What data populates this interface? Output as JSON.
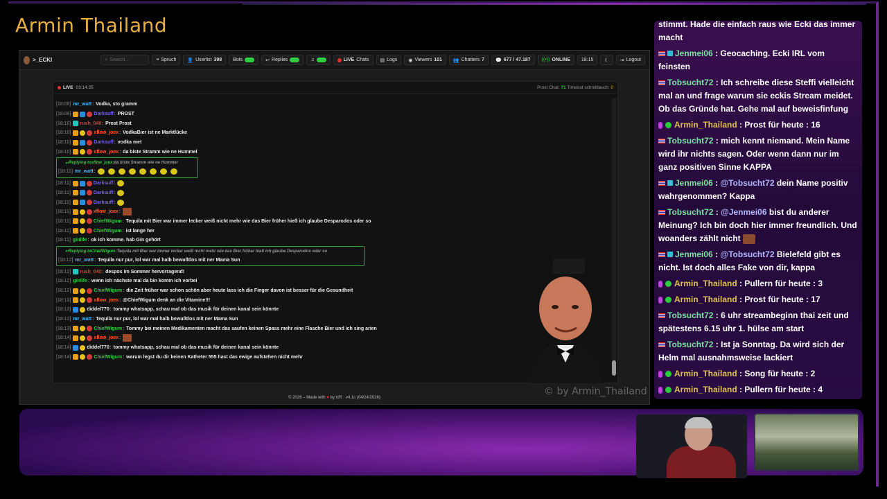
{
  "stream": {
    "title": "Armin Thailand",
    "watermark": "© by Armin_Thailand"
  },
  "navbar": {
    "brand": ">_ECKI",
    "search_placeholder": "Search...",
    "spruch": "Spruch",
    "userlist": "Userlist",
    "userlist_count": "398",
    "bots": "Bots",
    "replies": "Replies",
    "live": "LIVE",
    "chats": "Chats",
    "logs": "Logs",
    "viewers": "Viewers",
    "viewers_count": "101",
    "chatters": "Chatters",
    "chatters_count": "7",
    "messages": "677 / 47.187",
    "online": "ONLINE",
    "clock": "18:15",
    "logout": "Logout"
  },
  "panel": {
    "live_label": "LIVE",
    "uptime": "03:14:35",
    "prost_label": "Prost Chat:",
    "prost_count": "71",
    "timeout_label": "Timeout schnittlauch:",
    "timeout_count": "0"
  },
  "chat": [
    {
      "ts": "[18:09]",
      "user": "mr_watt",
      "color": "#4ab8ff",
      "badges": [],
      "text": "Vodka, sto gramm"
    },
    {
      "ts": "[18:09]",
      "user": "Darksuff",
      "color": "#7a5aff",
      "badges": [
        "crown",
        "sub",
        "mod"
      ],
      "text": "PROST"
    },
    {
      "ts": "[18:10]",
      "user": "rush_040",
      "color": "#e03a3a",
      "badges": [
        "gift"
      ],
      "text": "Prost Prost"
    },
    {
      "ts": "[18:10]",
      "user": "xflow_joex",
      "color": "#ff5a2a",
      "badges": [
        "crown",
        "coin",
        "mod"
      ],
      "text": "VodkaBier ist ne Marktlücke"
    },
    {
      "ts": "[18:10]",
      "user": "Darksuff",
      "color": "#7a5aff",
      "badges": [
        "crown",
        "sub",
        "mod"
      ],
      "text": "vodka met"
    },
    {
      "ts": "[18:10]",
      "user": "xflow_joex",
      "color": "#ff5a2a",
      "badges": [
        "crown",
        "coin",
        "mod"
      ],
      "text": "da biste Stramm wie ne Hummel"
    },
    {
      "reply_to": "xflow_joex",
      "reply_text": "da biste Stramm wie ne Hummel",
      "ts": "[18:11]",
      "user": "mr_watt",
      "color": "#4ab8ff",
      "badges": [],
      "text": "",
      "emotes": 8
    },
    {
      "ts": "[18:11]",
      "user": "Darksuff",
      "color": "#7a5aff",
      "badges": [
        "crown",
        "sub",
        "mod"
      ],
      "text": "",
      "emotes": 1
    },
    {
      "ts": "[18:11]",
      "user": "Darksuff",
      "color": "#7a5aff",
      "badges": [
        "crown",
        "sub",
        "mod"
      ],
      "text": "",
      "emotes": 1
    },
    {
      "ts": "[18:11]",
      "user": "Darksuff",
      "color": "#7a5aff",
      "badges": [
        "crown",
        "sub",
        "mod"
      ],
      "text": "",
      "emotes": 1
    },
    {
      "ts": "[18:11]",
      "user": "xflow_joex",
      "color": "#ff5a2a",
      "badges": [
        "crown",
        "coin",
        "mod"
      ],
      "text": "",
      "sqemote": true
    },
    {
      "ts": "[18:11]",
      "user": "ChiefWigum",
      "color": "#2ecc40",
      "badges": [
        "crown",
        "coin",
        "mod"
      ],
      "text": "Tequila mit Bier war immer lecker weiß nicht mehr wie das Bier früher hieß ich glaube Desparodos oder so"
    },
    {
      "ts": "[18:11]",
      "user": "ChiefWigum",
      "color": "#2ecc40",
      "badges": [
        "crown",
        "coin",
        "mod"
      ],
      "text": "ist lange her"
    },
    {
      "ts": "[18:11]",
      "user": "ginlife",
      "color": "#2ecc40",
      "badges": [],
      "text": "ok ich komme. hab Gin gehört"
    },
    {
      "reply_to": "ChiefWigum",
      "reply_text": "Tequila mit Bier war immer lecker weiß nicht mehr wie das Bier früher hieß ich glaube Desparodos oder so",
      "ts": "[18:12]",
      "user": "mr_watt",
      "color": "#4ab8ff",
      "badges": [],
      "text": "Tequila nur pur, lol war mal halb bewußtlos mit ner Mama Sun"
    },
    {
      "ts": "[18:12]",
      "user": "rush_040",
      "color": "#e03a3a",
      "badges": [
        "gift"
      ],
      "text": "despos im Sommer hervorragend!"
    },
    {
      "ts": "[18:12]",
      "user": "ginlife",
      "color": "#2ecc40",
      "badges": [],
      "text": "wenn ich nächste mal da bin komm ich vorbei"
    },
    {
      "ts": "[18:12]",
      "user": "ChiefWigum",
      "color": "#2ecc40",
      "badges": [
        "crown",
        "coin",
        "mod"
      ],
      "text": "die Zeit früher war schon schön aber heute lass ich die Finger davon ist besser für die Gesundheit"
    },
    {
      "ts": "[18:13]",
      "user": "xflow_joex",
      "color": "#ff5a2a",
      "badges": [
        "crown",
        "coin",
        "mod"
      ],
      "text": "@ChiefWigum denk an die Vitamine!!!"
    },
    {
      "ts": "[18:13]",
      "user": "diddel770",
      "color": "#eeeeee",
      "badges": [
        "sub",
        "coin"
      ],
      "text": "tommy whatsapp, schau mal ob das musik für deinen kanal sein könnte"
    },
    {
      "ts": "[18:13]",
      "user": "mr_watt",
      "color": "#4ab8ff",
      "badges": [],
      "text": "Tequila nur pur, lol war mal halb bewußtlos mit ner Mama Sun"
    },
    {
      "ts": "[18:13]",
      "user": "ChiefWigum",
      "color": "#2ecc40",
      "badges": [
        "crown",
        "coin",
        "mod"
      ],
      "text": "Tommy bei meinen Medikamenten macht das saufen keinen Spass mehr eine Flasche Bier und ich sing arien"
    },
    {
      "ts": "[18:14]",
      "user": "xflow_joex",
      "color": "#ff5a2a",
      "badges": [
        "crown",
        "coin",
        "mod"
      ],
      "text": "",
      "sqemote": true
    },
    {
      "ts": "[18:14]",
      "user": "diddel770",
      "color": "#eeeeee",
      "badges": [
        "sub",
        "coin"
      ],
      "text": "tommy whatsapp, schau mal ob das musik für deinen kanal sein könnte"
    },
    {
      "ts": "[18:14]",
      "user": "ChiefWigum",
      "color": "#2ecc40",
      "badges": [
        "crown",
        "coin",
        "mod"
      ],
      "text": "warum legst du dir keinen Katheter 555 hast das ewige aufstehen nicht mehr"
    }
  ],
  "footer": {
    "pre": "© 2026 – Made with",
    "post": "by tcR · v4.1c (04/24/2026)"
  },
  "side_chat": [
    {
      "type": "cont",
      "text": "stimmt. Hade die einfach raus wie Ecki das immer macht"
    },
    {
      "type": "flag-sub",
      "user": "Jenmei06",
      "text": "Geocaching. Ecki IRL vom feinsten"
    },
    {
      "type": "flag",
      "user": "Tobsucht72",
      "text": "Ich schreibe diese Steffi vielleicht mal an und frage warum sie eckis Stream meidet. Ob das Gründe hat. Gehe mal auf beweisfinfung"
    },
    {
      "type": "bot",
      "user": "Armin_Thailand",
      "text": "Prost für heute : 16"
    },
    {
      "type": "flag",
      "user": "Tobsucht72",
      "text": "mich kennt niemand. Mein Name wird ihr nichts sagen. Oder wenn dann nur im ganz positiven Sinne KAPPA"
    },
    {
      "type": "flag-sub",
      "user": "Jenmei06",
      "mention": "@Tobsucht72",
      "text": "dein Name positiv wahrgenommen? Kappa"
    },
    {
      "type": "flag",
      "user": "Tobsucht72",
      "mention": "@Jenmei06",
      "text": "bist du anderer Meinung? Ich bin doch hier immer freundlich. Und woanders zählt nicht",
      "emote": true
    },
    {
      "type": "flag-sub",
      "user": "Jenmei06",
      "mention": "@Tobsucht72",
      "text": "Bielefeld gibt es nicht. Ist doch alles Fake von dir, kappa"
    },
    {
      "type": "bot",
      "user": "Armin_Thailand",
      "text": "Pullern für heute : 3"
    },
    {
      "type": "bot",
      "user": "Armin_Thailand",
      "text": "Prost für heute : 17"
    },
    {
      "type": "flag",
      "user": "Tobsucht72",
      "text": "6 uhr streambeginn thai zeit und spätestens 6.15 uhr 1. hülse am start"
    },
    {
      "type": "flag",
      "user": "Tobsucht72",
      "text": "Ist ja Sonntag. Da wird sich der Helm mal ausnahmsweise lackiert"
    },
    {
      "type": "bot",
      "user": "Armin_Thailand",
      "text": "Song für heute : 2"
    },
    {
      "type": "bot",
      "user": "Armin_Thailand",
      "text": "Pullern für heute : 4"
    }
  ]
}
